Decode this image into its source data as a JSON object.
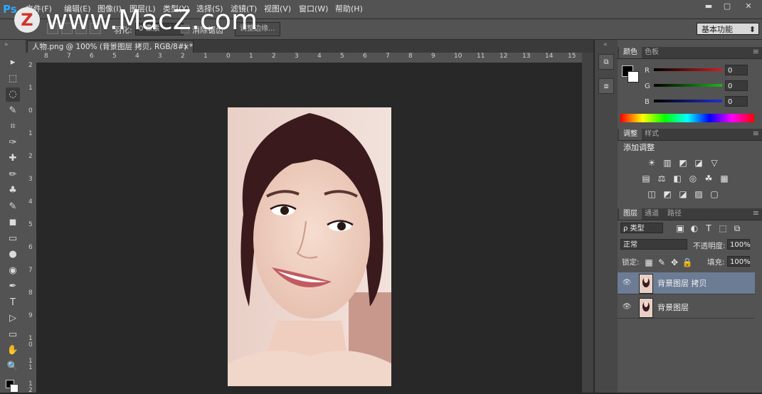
{
  "app": {
    "logo": "Ps"
  },
  "menu": [
    "文件(F)",
    "编辑(E)",
    "图像(I)",
    "图层(L)",
    "类型(Y)",
    "选择(S)",
    "滤镜(T)",
    "视图(V)",
    "窗口(W)",
    "帮助(H)"
  ],
  "watermark": {
    "badge": "Z",
    "text": "www.MacZ.com"
  },
  "window_controls": {
    "minimize": "▬",
    "maximize": "▢",
    "close": "✕"
  },
  "options": {
    "feather_label": "羽化:",
    "feather_value": "0 像素",
    "antialias_label": "消除锯齿",
    "refine_edge": "调整边缘..."
  },
  "workspace": "基本功能",
  "document": {
    "tab_title": "人物.png @ 100% (背景图层 拷贝, RGB/8#) *",
    "tab_close": "×",
    "ruler_top": [
      "8",
      "7",
      "6",
      "5",
      "4",
      "3",
      "2",
      "1",
      "0",
      "1",
      "2",
      "3",
      "4",
      "5",
      "6",
      "7",
      "8",
      "9",
      "10",
      "11",
      "12",
      "13",
      "14",
      "15"
    ],
    "ruler_left": [
      "2",
      "1",
      "0",
      "1",
      "2",
      "3",
      "4",
      "5",
      "6",
      "7",
      "8",
      "9",
      "1 0",
      "1 1",
      "1 2"
    ]
  },
  "color_panel": {
    "tabs": [
      "颜色",
      "色板"
    ],
    "channels": [
      {
        "label": "R",
        "value": "0",
        "color": "#d21f1f"
      },
      {
        "label": "G",
        "value": "0",
        "color": "#1fb31f"
      },
      {
        "label": "B",
        "value": "0",
        "color": "#1f2fd2"
      }
    ]
  },
  "adjust_panel": {
    "tabs": [
      "调整",
      "样式"
    ],
    "title": "添加调整",
    "icons_row1": [
      "☀",
      "▥",
      "◩",
      "◪",
      "▽"
    ],
    "icons_row2": [
      "▤",
      "⚖",
      "◧",
      "◎",
      "☘",
      "▦"
    ],
    "icons_row3": [
      "◫",
      "◩",
      "◪",
      "▨",
      "▢"
    ]
  },
  "layers_panel": {
    "tabs": [
      "图层",
      "通道",
      "路径"
    ],
    "filter_label": "ρ 类型",
    "blend_mode": "正常",
    "opacity_label": "不透明度:",
    "opacity_value": "100%",
    "lock_label": "锁定:",
    "fill_label": "填充:",
    "fill_value": "100%",
    "layers": [
      {
        "name": "背景图层 拷贝",
        "selected": true
      },
      {
        "name": "背景图层",
        "selected": false
      }
    ]
  },
  "tools": [
    "▸",
    "⬚",
    "◌",
    "✎",
    "⌗",
    "✑",
    "✚",
    "✏",
    "♣",
    "✎",
    "◼",
    "▭",
    "●",
    "◉",
    "✒",
    "T",
    "▷",
    "▭",
    "✋",
    "🔍"
  ]
}
